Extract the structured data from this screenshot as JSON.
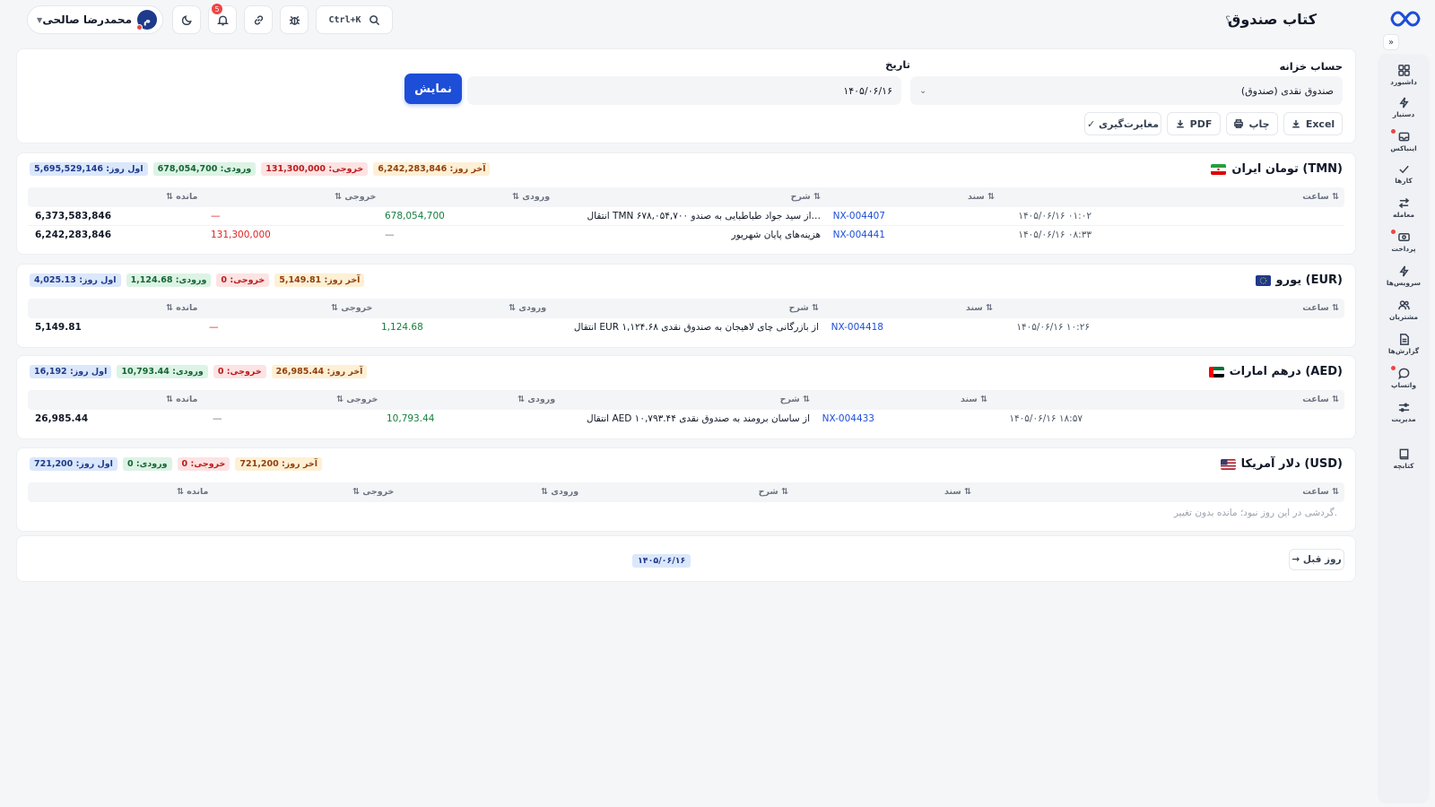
{
  "header": {
    "title": "کتاب صندوق",
    "help": "؟",
    "search_shortcut": "Ctrl+K",
    "notifications_count": "5",
    "user_name": "محمدرضا صالحی",
    "user_initial": "م"
  },
  "sidebar": {
    "items": [
      {
        "label": "داشبورد",
        "icon": "grid-icon"
      },
      {
        "label": "دستیار",
        "icon": "bolt-icon"
      },
      {
        "label": "اینباکس",
        "icon": "inbox-icon"
      },
      {
        "label": "کارها",
        "icon": "check-icon"
      },
      {
        "label": "معامله",
        "icon": "swap-icon"
      },
      {
        "label": "پرداخت",
        "icon": "cash-icon"
      },
      {
        "label": "سرویس‌ها",
        "icon": "bolt-icon"
      },
      {
        "label": "مشتریان",
        "icon": "users-icon"
      },
      {
        "label": "گزارش‌ها",
        "icon": "report-icon"
      },
      {
        "label": "واتساپ",
        "icon": "chat-icon"
      },
      {
        "label": "مدیریت",
        "icon": "sliders-icon"
      },
      {
        "label": "کتابچه",
        "icon": "book-icon"
      }
    ]
  },
  "filters": {
    "account_label": "حساب خزانه",
    "account_value": "صندوق نقدی (صندوق)",
    "date_label": "تاریخ",
    "date_value": "۱۴۰۵/۰۶/۱۶",
    "show_button": "نمایش",
    "excel": "Excel",
    "print": "چاپ",
    "pdf": "PDF",
    "reconcile": "✓ مغایرت‌گیری"
  },
  "columns": {
    "time": "ساعت ⇅",
    "doc": "سند ⇅",
    "desc": "شرح ⇅",
    "in": "⇅ ورودی",
    "out": "⇅ خروجی",
    "balance": "⇅ مانده"
  },
  "sections": [
    {
      "title": "تومان ایران (TMN)",
      "open": "اول روز: 5,695,529,146",
      "in": "ورودی: 678,054,700",
      "out": "خروجی: 131,300,000",
      "close": "آخر روز: 6,242,283,846",
      "rows": [
        {
          "time": "۱۴۰۵/۰۶/۱۶ ۰۱:۰۲",
          "doc": "NX-004407",
          "desc": "انتقال TMN ۶۷۸,۰۵۴,۷۰۰ از سید جواد طباطبایی به صندو…",
          "in": "678,054,700",
          "out": "—",
          "balance": "6,373,583,846"
        },
        {
          "time": "۱۴۰۵/۰۶/۱۶ ۰۸:۳۳",
          "doc": "NX-004441",
          "desc": "هزینه‌های پایان شهریور",
          "in": "—",
          "out": "131,300,000",
          "balance": "6,242,283,846"
        }
      ]
    },
    {
      "title": "یورو (EUR)",
      "open": "اول روز: 4,025.13",
      "in": "ورودی: 1,124.68",
      "out": "خروجی: 0",
      "close": "آخر روز: 5,149.81",
      "rows": [
        {
          "time": "۱۴۰۵/۰۶/۱۶ ۱۰:۲۶",
          "doc": "NX-004418",
          "desc": "انتقال EUR ۱,۱۲۴.۶۸ از بازرگانی چای لاهیجان به صندوق نقدی",
          "in": "1,124.68",
          "out": "—",
          "balance": "5,149.81"
        }
      ]
    },
    {
      "title": "درهم امارات (AED)",
      "open": "اول روز: 16,192",
      "in": "ورودی: 10,793.44",
      "out": "خروجی: 0",
      "close": "آخر روز: 26,985.44",
      "rows": [
        {
          "time": "۱۴۰۵/۰۶/۱۶ ۱۸:۵۷",
          "doc": "NX-004433",
          "desc": "انتقال AED ۱۰,۷۹۳.۴۴ از ساسان برومند به صندوق نقدی",
          "in": "10,793.44",
          "out": "—",
          "balance": "26,985.44"
        }
      ]
    },
    {
      "title": "دلار آمریکا (USD)",
      "open": "اول روز: 721,200",
      "in": "ورودی: 0",
      "out": "خروجی: 0",
      "close": "آخر روز: 721,200",
      "empty": "گردشی در این روز نبود؛ مانده بدون تغییر."
    }
  ],
  "footer": {
    "prev_day": "→ روز قبل",
    "current_date": "۱۴۰۵/۰۶/۱۶"
  },
  "colors": {
    "primary": "#1d4ed8",
    "in": "#15803d",
    "out": "#dc2626"
  }
}
